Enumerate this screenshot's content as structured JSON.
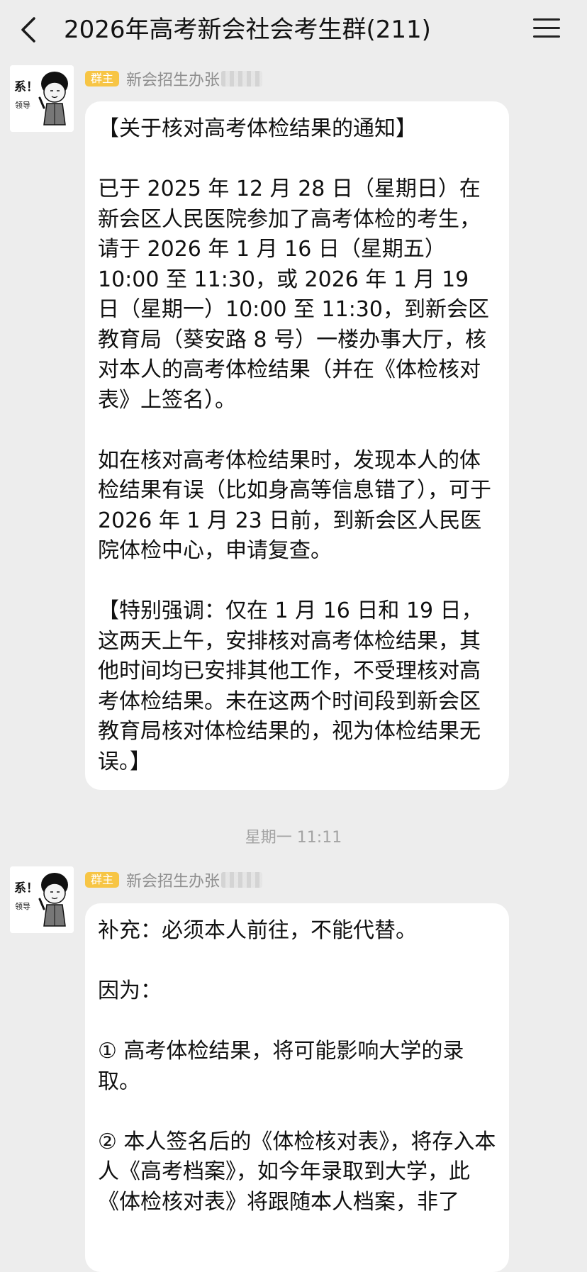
{
  "header": {
    "title": "2026年高考新会社会考生群(211)"
  },
  "messages": [
    {
      "role_badge": "群主",
      "sender": "新会招生办张",
      "avatar": {
        "text_top": "系！",
        "text_bottom": "领导"
      },
      "paragraphs": [
        "【关于核对高考体检结果的通知】",
        "已于 2025 年 12 月 28 日（星期日）在新会区人民医院参加了高考体检的考生，请于 2026 年 1 月 16 日（星期五）10:00 至 11:30，或 2026 年 1 月 19 日（星期一）10:00 至 11:30，到新会区教育局（葵安路 8 号）一楼办事大厅，核对本人的高考体检结果（并在《体检核对表》上签名）。",
        "如在核对高考体检结果时，发现本人的体检结果有误（比如身高等信息错了），可于 2026 年 1 月 23 日前，到新会区人民医院体检中心，申请复查。",
        "【特别强调：仅在 1 月 16 日和 19 日，这两天上午，安排核对高考体检结果，其他时间均已安排其他工作，不受理核对高考体检结果。未在这两个时间段到新会区教育局核对体检结果的，视为体检结果无误。】"
      ]
    },
    {
      "role_badge": "群主",
      "sender": "新会招生办张",
      "avatar": {
        "text_top": "系！",
        "text_bottom": "领导"
      },
      "paragraphs": [
        "补充：必须本人前往，不能代替。",
        "因为：",
        "① 高考体检结果，将可能影响大学的录取。",
        "② 本人签名后的《体检核对表》，将存入本人《高考档案》，如今年录取到大学，此《体检核对表》将跟随本人档案，非了"
      ]
    }
  ],
  "timestamp": "星期一 11:11"
}
